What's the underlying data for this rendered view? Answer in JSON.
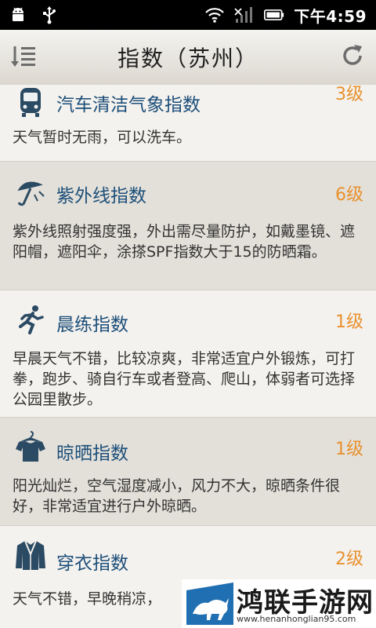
{
  "status_bar": {
    "time": "下午4:59"
  },
  "header": {
    "title": "指数（苏州）"
  },
  "cards": [
    {
      "icon": "car-wash-bus-icon",
      "title": "汽车清洁气象指数",
      "level": "3级",
      "text": "天气暂时无雨，可以洗车。"
    },
    {
      "icon": "umbrella-uv-icon",
      "title": "紫外线指数",
      "level": "6级",
      "text": "紫外线照射强度强，外出需尽量防护，如戴墨镜、遮阳帽，遮阳伞，涂搽SPF指数大于15的防晒霜。"
    },
    {
      "icon": "runner-icon",
      "title": "晨练指数",
      "level": "1级",
      "text": "早晨天气不错，比较凉爽，非常适宜户外锻炼，可打拳，跑步、骑自行车或者登高、爬山，体弱者可选择公园里散步。"
    },
    {
      "icon": "tshirt-hanger-icon",
      "title": "晾晒指数",
      "level": "1级",
      "text": "阳光灿烂，空气湿度减小，风力不大，晾晒条件很好，非常适宜进行户外晾晒。"
    },
    {
      "icon": "jacket-icon",
      "title": "穿衣指数",
      "level": "2级",
      "text": "天气不错，早晚稍凉，"
    }
  ],
  "watermark": {
    "main": "鸿联手游网",
    "sub": "www.henanhonglian95.com"
  }
}
